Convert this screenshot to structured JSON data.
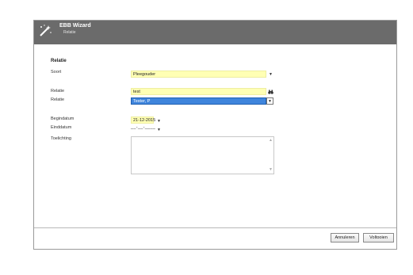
{
  "header": {
    "title": "EBB Wizard",
    "subtitle": "Relatie",
    "icon": "magic-wand-icon",
    "background": "#6b6b6b"
  },
  "form": {
    "section_title": "Relatie",
    "soort": {
      "label": "Soort",
      "value": "Pleegouder"
    },
    "relatie_search": {
      "label": "Relatie",
      "value": "test",
      "icon": "binoculars-icon"
    },
    "relatie_select": {
      "label": "Relatie",
      "value": "Tester, P"
    },
    "begindatum": {
      "label": "Begindatum",
      "value": "21-12-2015"
    },
    "einddatum": {
      "label": "Einddatum",
      "value": "__-__-____"
    },
    "toelichting": {
      "label": "Toelichting",
      "value": ""
    }
  },
  "footer": {
    "cancel_label": "Annuleren",
    "finish_label": "Voltooien"
  },
  "colors": {
    "required_field": "#ffffb4",
    "selection": "#3f85dc"
  }
}
